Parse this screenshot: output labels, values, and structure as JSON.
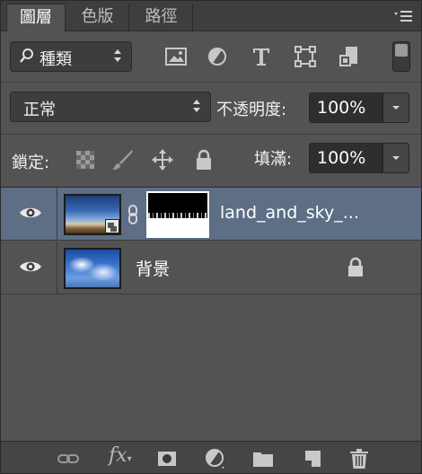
{
  "tabs": [
    {
      "label": "圖層",
      "active": true
    },
    {
      "label": "色版",
      "active": false
    },
    {
      "label": "路徑",
      "active": false
    }
  ],
  "filter": {
    "kind_label": "種類",
    "icons": [
      "image-filter-icon",
      "adjustment-filter-icon",
      "type-filter-icon",
      "shape-filter-icon",
      "smart-object-filter-icon"
    ]
  },
  "blend": {
    "mode": "正常",
    "opacity_label": "不透明度:",
    "opacity_value": "100%"
  },
  "lock": {
    "label": "鎖定:",
    "fill_label": "填滿:",
    "fill_value": "100%"
  },
  "layers": [
    {
      "name": "land_and_sky_...",
      "selected": true,
      "visible": true,
      "has_mask": true,
      "smart_object": true
    },
    {
      "name": "背景",
      "selected": false,
      "visible": true,
      "locked": true
    }
  ],
  "colors": {
    "panel_bg": "#535353",
    "selected_row": "#5d6e85"
  }
}
